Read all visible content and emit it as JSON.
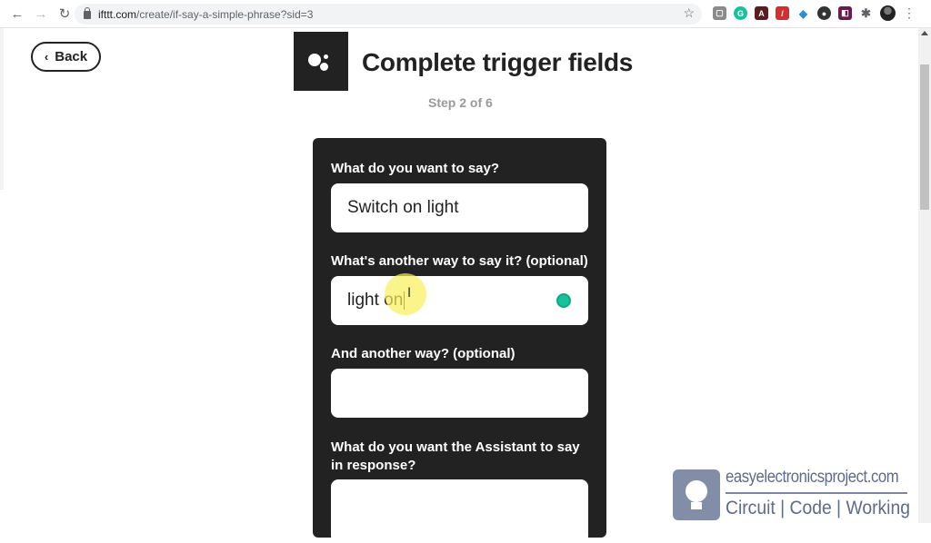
{
  "browser": {
    "url_host": "ifttt.com",
    "url_path": "/create/if-say-a-simple-phrase?sid=3",
    "nav": {
      "back_icon": "←",
      "forward_icon": "→",
      "reload_icon": "↻"
    },
    "star_icon": "☆",
    "extensions": [
      {
        "name": "extension-generic-icon",
        "glyph": "▢",
        "color": "#8a8a8a"
      },
      {
        "name": "grammarly-extension-icon",
        "glyph": "G",
        "color": "#15c39a"
      },
      {
        "name": "acrobat-extension-icon",
        "glyph": "A",
        "color": "#5a1d1d"
      },
      {
        "name": "pdf-extension-icon",
        "glyph": "/",
        "color": "#d32f2f"
      },
      {
        "name": "feedly-extension-icon",
        "glyph": "◆",
        "color": "#2b8fd6"
      },
      {
        "name": "dark-extension-icon",
        "glyph": "●",
        "color": "#333333"
      },
      {
        "name": "purple-extension-icon",
        "glyph": "◧",
        "color": "#6a1b4d"
      }
    ],
    "puzzle_icon": "✱",
    "menu_icon": "⋮"
  },
  "page": {
    "back_label": "Back",
    "back_icon": "‹",
    "title": "Complete trigger fields",
    "step": "Step 2 of 6",
    "fields": [
      {
        "label": "What do you want to say?",
        "value": "Switch on light"
      },
      {
        "label": "What's another way to say it? (optional)",
        "value": "light on"
      },
      {
        "label": "And another way? (optional)",
        "value": ""
      },
      {
        "label": "What do you want the Assistant to say in response?",
        "value": ""
      }
    ],
    "cursor_icon": "I"
  },
  "watermark": {
    "site": "easyelectronicsproject.com",
    "tagline": "Circuit | Code | Working"
  }
}
